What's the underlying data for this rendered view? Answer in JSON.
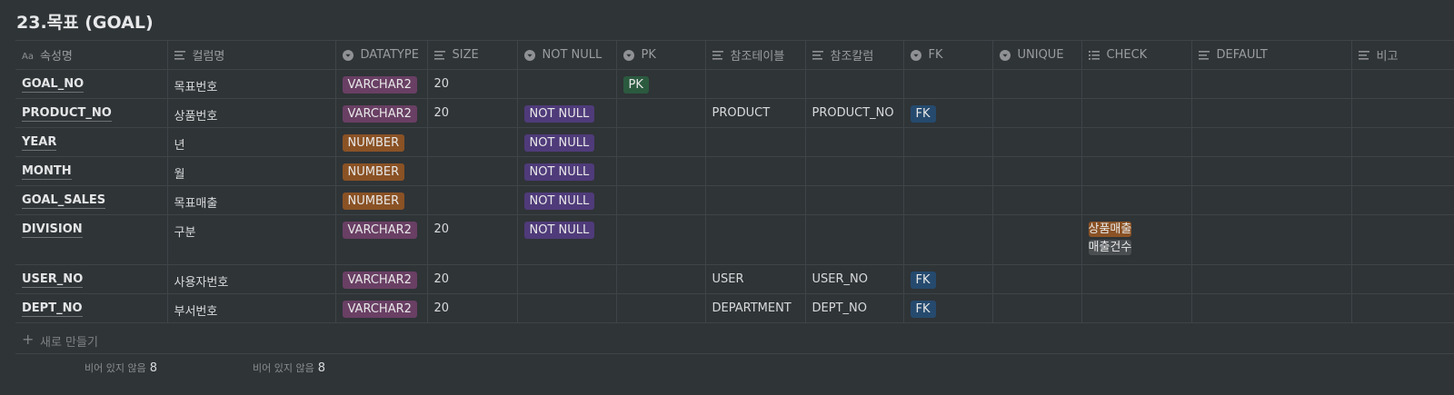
{
  "page_title": "23.목표 (GOAL)",
  "columns": [
    {
      "label": "속성명",
      "icon": "title-icon"
    },
    {
      "label": "컬럼명",
      "icon": "text-icon"
    },
    {
      "label": "DATATYPE",
      "icon": "select-icon"
    },
    {
      "label": "SIZE",
      "icon": "text-icon"
    },
    {
      "label": "NOT NULL",
      "icon": "select-icon"
    },
    {
      "label": "PK",
      "icon": "select-icon"
    },
    {
      "label": "참조테이블",
      "icon": "text-icon"
    },
    {
      "label": "참조칼럼",
      "icon": "text-icon"
    },
    {
      "label": "FK",
      "icon": "select-icon"
    },
    {
      "label": "UNIQUE",
      "icon": "select-icon"
    },
    {
      "label": "CHECK",
      "icon": "multiselect-icon"
    },
    {
      "label": "DEFAULT",
      "icon": "text-icon"
    },
    {
      "label": "비고",
      "icon": "text-icon"
    }
  ],
  "rows": [
    {
      "attr": "GOAL_NO",
      "col": "목표번호",
      "datatype": "VARCHAR2",
      "size": "20",
      "notnull": "",
      "pk": "PK",
      "ref_table": "",
      "ref_col": "",
      "fk": "",
      "unique": "",
      "check": [],
      "default": "",
      "note": ""
    },
    {
      "attr": "PRODUCT_NO",
      "col": "상품번호",
      "datatype": "VARCHAR2",
      "size": "20",
      "notnull": "NOT NULL",
      "pk": "",
      "ref_table": "PRODUCT",
      "ref_col": "PRODUCT_NO",
      "fk": "FK",
      "unique": "",
      "check": [],
      "default": "",
      "note": ""
    },
    {
      "attr": "YEAR",
      "col": "년",
      "datatype": "NUMBER",
      "size": "",
      "notnull": "NOT NULL",
      "pk": "",
      "ref_table": "",
      "ref_col": "",
      "fk": "",
      "unique": "",
      "check": [],
      "default": "",
      "note": ""
    },
    {
      "attr": "MONTH",
      "col": "월",
      "datatype": "NUMBER",
      "size": "",
      "notnull": "NOT NULL",
      "pk": "",
      "ref_table": "",
      "ref_col": "",
      "fk": "",
      "unique": "",
      "check": [],
      "default": "",
      "note": ""
    },
    {
      "attr": "GOAL_SALES",
      "col": "목표매출",
      "datatype": "NUMBER",
      "size": "",
      "notnull": "NOT NULL",
      "pk": "",
      "ref_table": "",
      "ref_col": "",
      "fk": "",
      "unique": "",
      "check": [],
      "default": "",
      "note": ""
    },
    {
      "attr": "DIVISION",
      "col": "구분",
      "datatype": "VARCHAR2",
      "size": "20",
      "notnull": "NOT NULL",
      "pk": "",
      "ref_table": "",
      "ref_col": "",
      "fk": "",
      "unique": "",
      "check": [
        "상품매출",
        "매출건수"
      ],
      "default": "",
      "note": ""
    },
    {
      "attr": "USER_NO",
      "col": "사용자번호",
      "datatype": "VARCHAR2",
      "size": "20",
      "notnull": "",
      "pk": "",
      "ref_table": "USER",
      "ref_col": "USER_NO",
      "fk": "FK",
      "unique": "",
      "check": [],
      "default": "",
      "note": ""
    },
    {
      "attr": "DEPT_NO",
      "col": "부서번호",
      "datatype": "VARCHAR2",
      "size": "20",
      "notnull": "",
      "pk": "",
      "ref_table": "DEPARTMENT",
      "ref_col": "DEPT_NO",
      "fk": "FK",
      "unique": "",
      "check": [],
      "default": "",
      "note": ""
    }
  ],
  "new_row_label": "새로 만들기",
  "summaries": [
    {
      "label": "비어 있지 않음",
      "value": "8"
    },
    {
      "label": "비어 있지 않음",
      "value": "8"
    }
  ],
  "colors": {
    "background": "#2f3437",
    "varchar2": "#693f64",
    "number": "#8a5225",
    "not_null": "#4f3b7a",
    "pk": "#2b5a3f",
    "fk": "#254a6e",
    "check_sales": "#8a5225",
    "check_count": "#4a4e51"
  }
}
